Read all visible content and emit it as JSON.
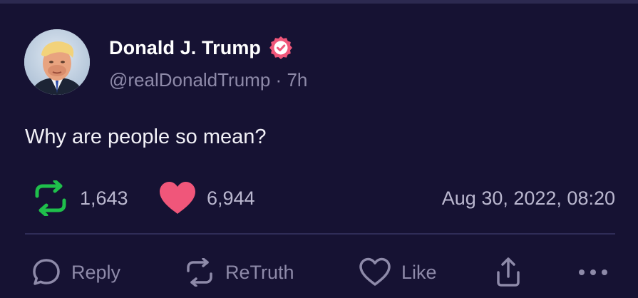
{
  "post": {
    "author": {
      "display_name": "Donald J. Trump",
      "verified": true,
      "handle": "@realDonaldTrump",
      "separator": "·",
      "relative_time": "7h"
    },
    "text": "Why are people so mean?",
    "stats": {
      "retruths": "1,643",
      "likes": "6,944",
      "timestamp": "Aug 30, 2022, 08:20"
    }
  },
  "actions": {
    "reply": "Reply",
    "retruth": "ReTruth",
    "like": "Like"
  },
  "icons": {
    "retruth_stat": "retruth-icon",
    "like_stat": "heart-icon",
    "reply": "comment-icon",
    "retruth": "retruth-icon",
    "like": "heart-outline-icon",
    "share": "share-icon",
    "more": "more-icon",
    "verified": "verified-badge-icon"
  },
  "colors": {
    "background": "#161233",
    "accent_green": "#1fbf4b",
    "accent_pink": "#f0567a",
    "muted_text": "#8e8aa9",
    "divider": "#2f2c57"
  }
}
